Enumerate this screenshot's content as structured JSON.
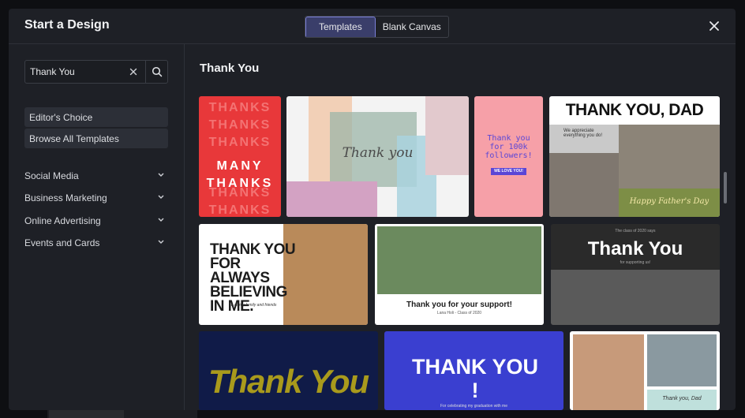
{
  "dialog": {
    "title": "Start a Design",
    "tabs": [
      {
        "label": "Templates",
        "active": true
      },
      {
        "label": "Blank Canvas",
        "active": false
      }
    ]
  },
  "sidebar": {
    "search_value": "Thank You",
    "buttons": [
      "Editor's Choice",
      "Browse All Templates"
    ],
    "categories": [
      "Social Media",
      "Business Marketing",
      "Online Advertising",
      "Events and Cards"
    ]
  },
  "main": {
    "heading": "Thank You",
    "templates": [
      {
        "name": "many-thanks",
        "text": "MANY THANKS",
        "bg_text": "THANKS",
        "color": "#e8383a"
      },
      {
        "name": "thank-you-brush",
        "text": "Thank you",
        "color": "#f2f2f2"
      },
      {
        "name": "thank-you-followers",
        "text": "Thank you for 100k followers!",
        "button": "WE LOVE YOU!",
        "color": "#f6a0a8"
      },
      {
        "name": "thank-you-dad",
        "text": "THANK YOU, DAD",
        "sub": "We appreciate everything you do!",
        "footer": "Happy Father's Day",
        "color": "#ffffff"
      },
      {
        "name": "thank-you-believing",
        "text": "THANK YOU FOR ALWAYS BELIEVING IN ME.",
        "sub": "To all my family and friends",
        "color": "#ffffff"
      },
      {
        "name": "thank-you-support",
        "text": "Thank you for your support!",
        "sub": "Lana Holi - Class of 2020",
        "color": "#ffffff"
      },
      {
        "name": "thank-you-graduates",
        "text": "Thank You",
        "sub_top": "The class of 2020 says",
        "sub": "for supporting us!",
        "color": "#2a2a2a"
      },
      {
        "name": "thank-you-stars",
        "text": "Thank You",
        "color": "#101b48"
      },
      {
        "name": "thank-you-fireworks",
        "text": "THANK YOU !",
        "sub": "For celebrating my graduation with me",
        "color": "#3a3fd0"
      },
      {
        "name": "thank-you-dad-photos",
        "text": "Thank you, Dad",
        "color": "#ffffff"
      }
    ]
  }
}
